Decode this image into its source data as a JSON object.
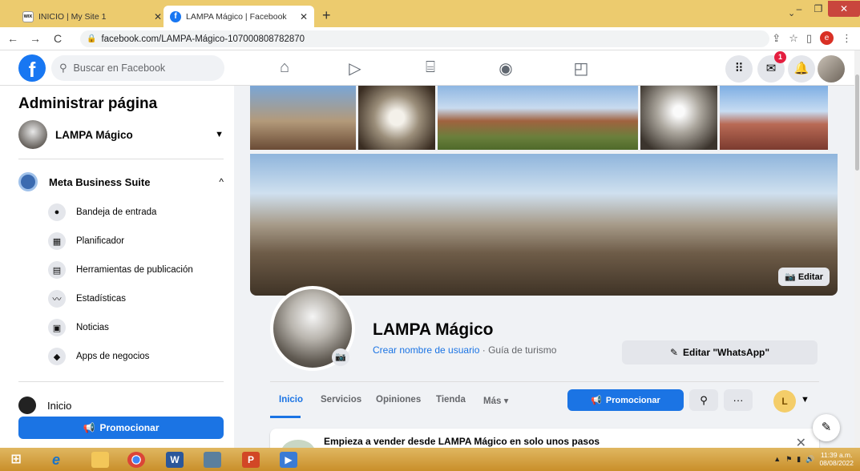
{
  "browser": {
    "tabs": [
      {
        "title": "INICIO | My Site 1",
        "favicon": "wix"
      },
      {
        "title": "LAMPA Mágico | Facebook",
        "favicon": "f"
      }
    ],
    "url": "facebook.com/LAMPA-Mágico-107000808782870",
    "profile_initial": "e"
  },
  "header": {
    "logo": "f",
    "search_placeholder": "Buscar en Facebook",
    "messenger_badge": "1"
  },
  "sidebar": {
    "title": "Administrar página",
    "page_name": "LAMPA Mágico",
    "section": "Meta Business Suite",
    "items": [
      {
        "label": "Bandeja de entrada",
        "icon": "chat-icon"
      },
      {
        "label": "Planificador",
        "icon": "calendar-icon"
      },
      {
        "label": "Herramientas de publicación",
        "icon": "publishing-icon"
      },
      {
        "label": "Estadísticas",
        "icon": "stats-icon"
      },
      {
        "label": "Noticias",
        "icon": "news-icon"
      },
      {
        "label": "Apps de negocios",
        "icon": "apps-icon"
      }
    ],
    "inicio": "Inicio",
    "promote": "Promocionar"
  },
  "page": {
    "cover_edit": "Editar",
    "name": "LAMPA Mágico",
    "username_link": "Crear nombre de usuario",
    "category": " · Guía de turismo",
    "whatsapp_button": "Editar \"WhatsApp\"",
    "tabs": [
      "Inicio",
      "Servicios",
      "Opiniones",
      "Tienda",
      "Más"
    ],
    "promote_button": "Promocionar",
    "avatar_initial": "L",
    "sell_card_text": "Empieza a vender desde LAMPA Mágico en solo unos pasos"
  },
  "taskbar": {
    "time": "11:39 a.m.",
    "date": "08/08/2022"
  }
}
